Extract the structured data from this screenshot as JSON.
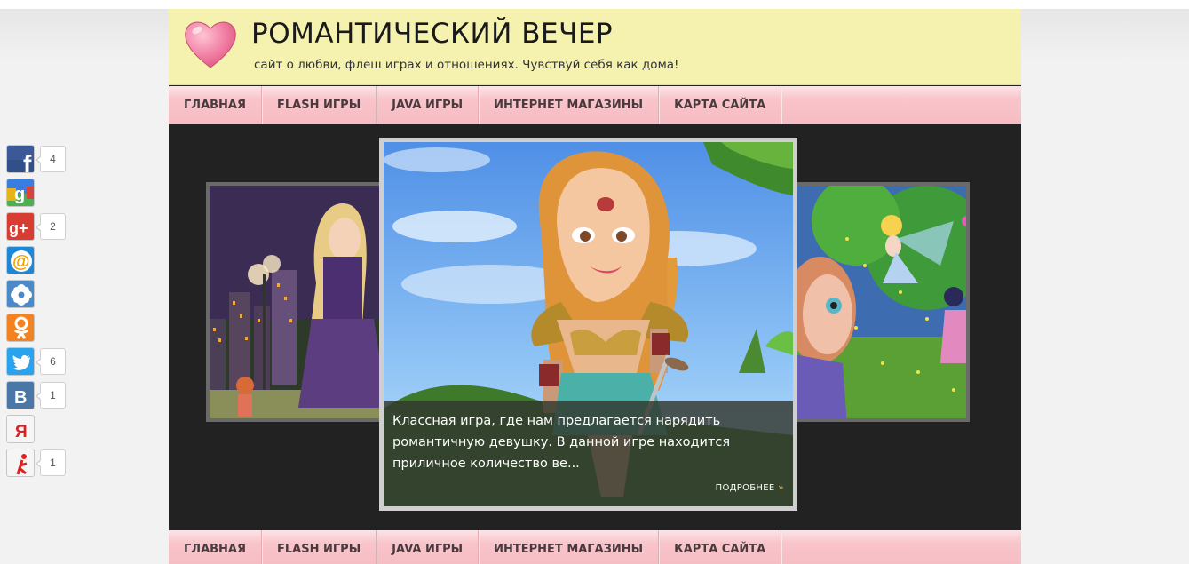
{
  "header": {
    "title": "РОМАНТИЧЕСКИЙ ВЕЧЕР",
    "description": "сайт о любви, флеш играх и отношениях. Чувствуй себя как дома!"
  },
  "nav": [
    {
      "label": "ГЛАВНАЯ"
    },
    {
      "label": "FLASH ИГРЫ"
    },
    {
      "label": "JAVA ИГРЫ"
    },
    {
      "label": "ИНТЕРНЕТ МАГАЗИНЫ"
    },
    {
      "label": "КАРТА САЙТА"
    }
  ],
  "slider": {
    "caption": "Классная игра, где нам предлагается нарядить романтичную девушку. В данной игре находится приличное количество ве...",
    "read_more": "ПОДРОБНЕЕ",
    "read_more_arrow": "»"
  },
  "share": [
    {
      "icon": "facebook-icon",
      "glyph": "f",
      "color": "#3b5998",
      "count": "4"
    },
    {
      "icon": "google-icon",
      "glyph": "g",
      "color": "#4caf50",
      "count": ""
    },
    {
      "icon": "google-plus-icon",
      "glyph": "g+",
      "color": "#d73d32",
      "count": "2"
    },
    {
      "icon": "mail-ru-icon",
      "glyph": "@",
      "color": "#168de2",
      "count": ""
    },
    {
      "icon": "moi-mir-icon",
      "glyph": "✿",
      "color": "#4a8ac9",
      "count": ""
    },
    {
      "icon": "odnoklassniki-icon",
      "glyph": "ok",
      "color": "#f58220",
      "count": ""
    },
    {
      "icon": "twitter-icon",
      "glyph": "t",
      "color": "#2aa3ef",
      "count": "6"
    },
    {
      "icon": "vkontakte-icon",
      "glyph": "B",
      "color": "#4a76a8",
      "count": "1"
    },
    {
      "icon": "yandex-icon",
      "glyph": "Я",
      "color": "#f5f5f5",
      "count": ""
    },
    {
      "icon": "ya-ru-icon",
      "glyph": "Я",
      "color": "#f5f5f5",
      "count": "1"
    }
  ]
}
